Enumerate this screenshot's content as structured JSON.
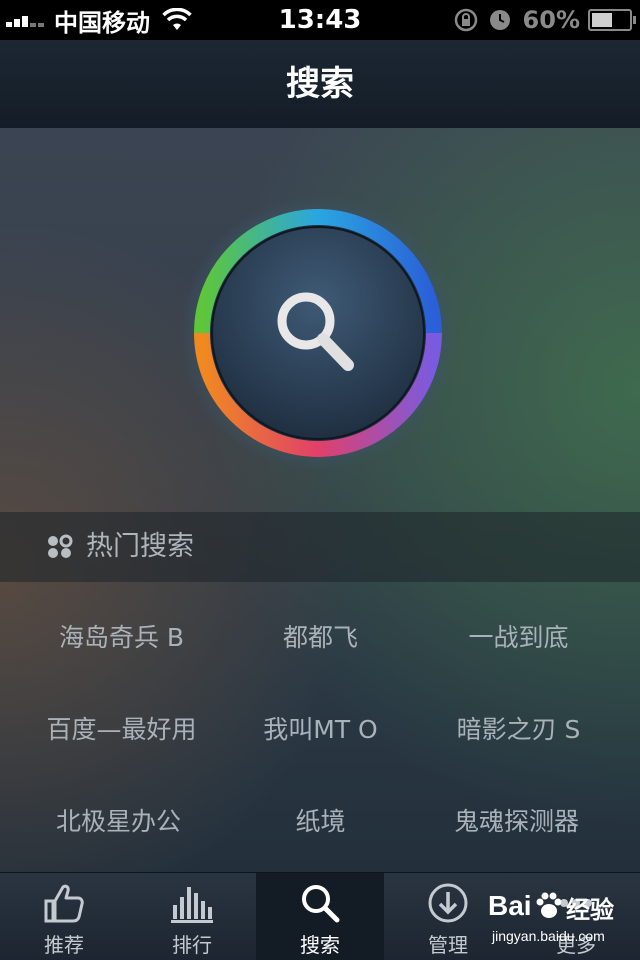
{
  "status_bar": {
    "carrier": "中国移动",
    "time": "13:43",
    "battery_percent": "60%",
    "battery_level": 0.6
  },
  "nav": {
    "title": "搜索"
  },
  "hot_search": {
    "title": "热门搜索",
    "keywords": [
      [
        "海岛奇兵 B",
        "都都飞",
        "一战到底"
      ],
      [
        "百度—最好用",
        "我叫MT O",
        "暗影之刃 S"
      ],
      [
        "北极星办公",
        "纸境",
        "鬼魂探测器"
      ]
    ]
  },
  "tabs": [
    {
      "label": "推荐",
      "icon": "thumbs-up-icon"
    },
    {
      "label": "排行",
      "icon": "bar-chart-icon"
    },
    {
      "label": "搜索",
      "icon": "search-icon",
      "active": true
    },
    {
      "label": "管理",
      "icon": "download-circle-icon"
    },
    {
      "label": "更多",
      "icon": "more-icon"
    }
  ],
  "watermark": {
    "logo_text": "Bai",
    "logo_text_2": "经验",
    "url": "jingyan.baidu.com"
  }
}
